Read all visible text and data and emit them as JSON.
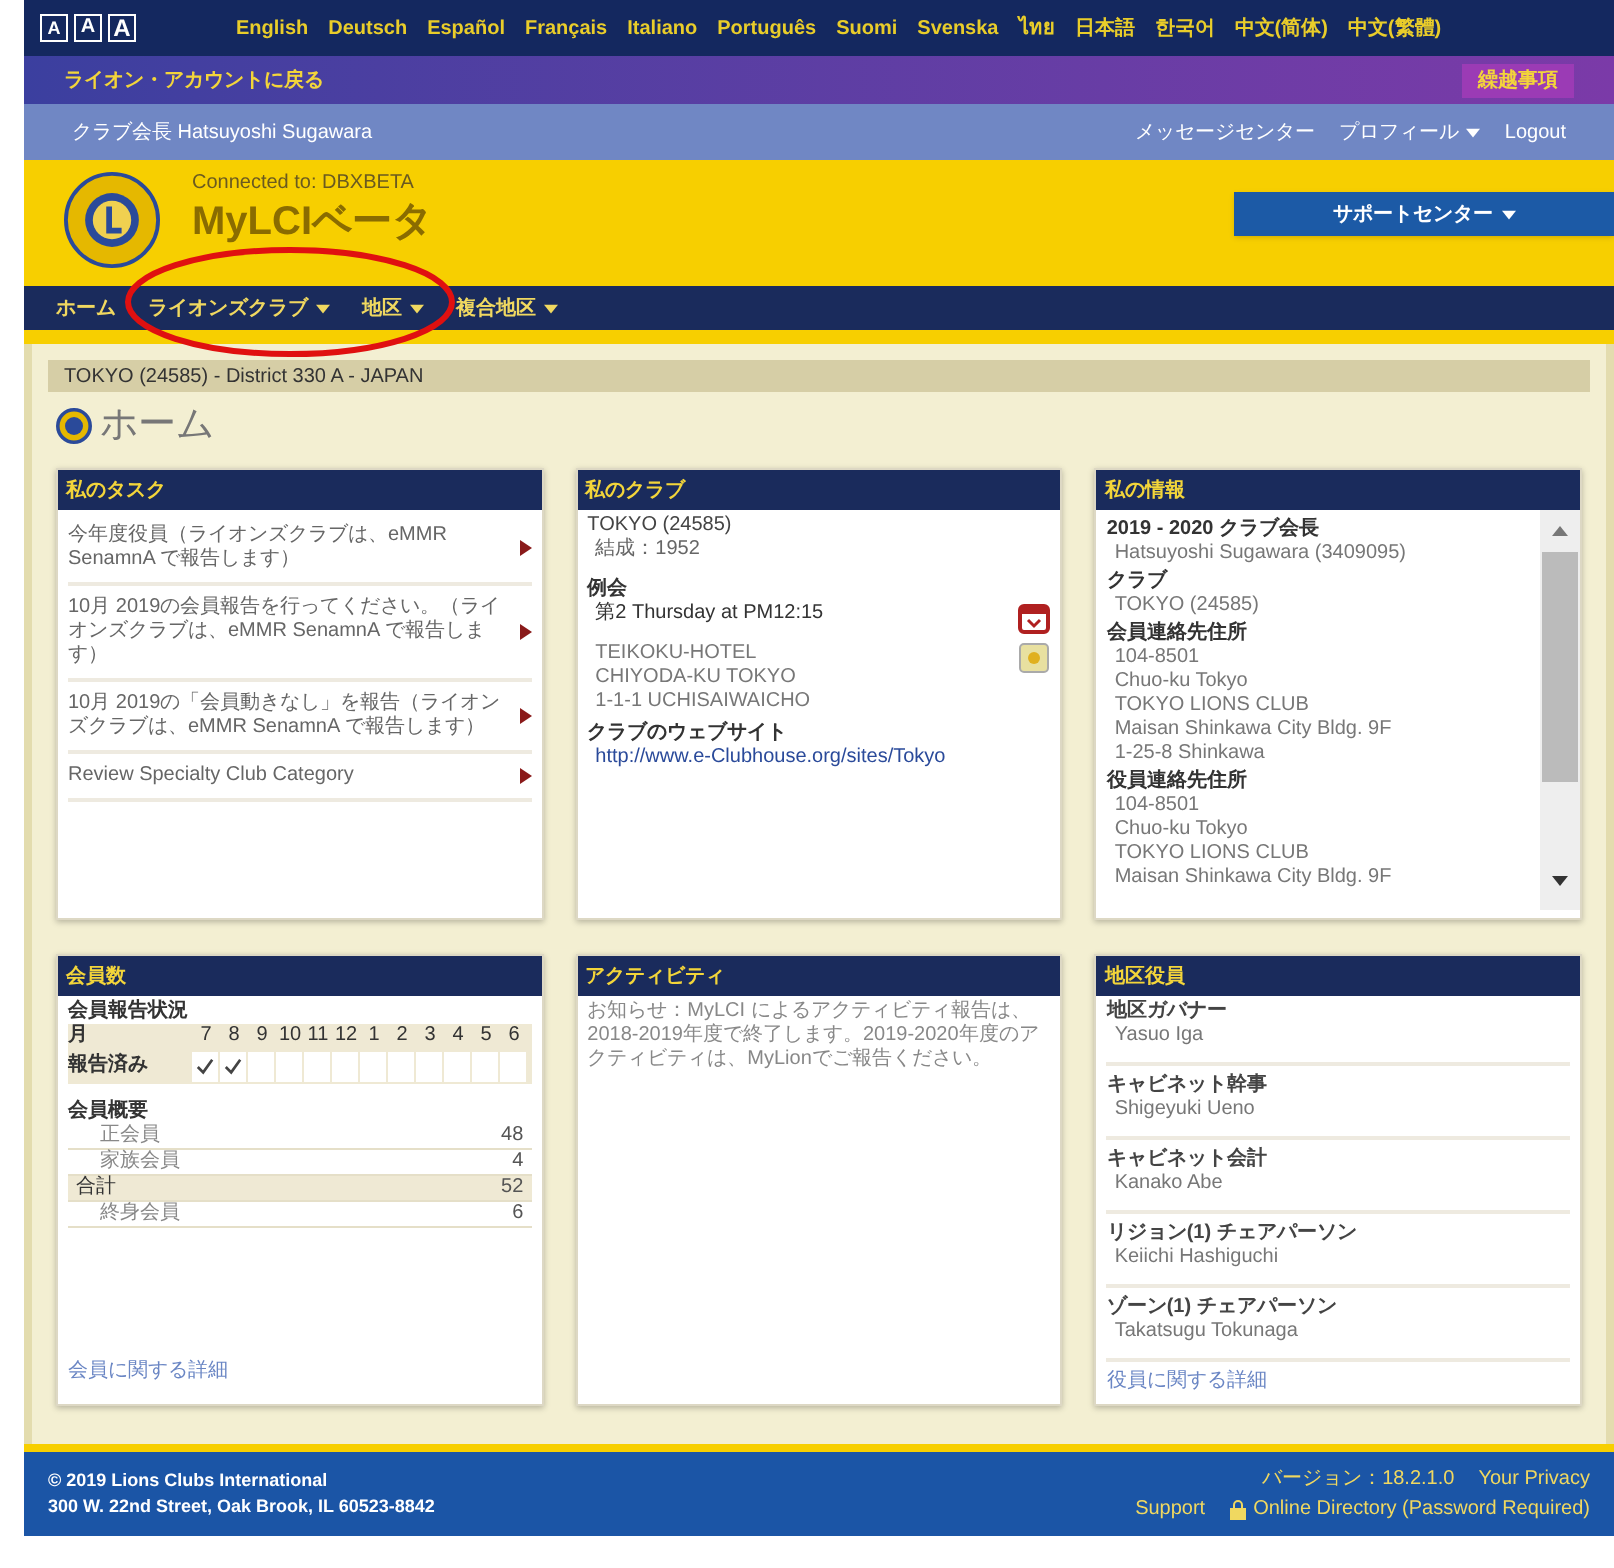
{
  "font_size_buttons": [
    "A",
    "A",
    "A"
  ],
  "languages": [
    "English",
    "Deutsch",
    "Español",
    "Français",
    "Italiano",
    "Português",
    "Suomi",
    "Svenska",
    "ไทย",
    "日本語",
    "한국어",
    "中文(简体)",
    "中文(繁體)"
  ],
  "account_bar": {
    "back_link": "ライオン・アカウントに戻る",
    "badge": "繰越事項"
  },
  "user_bar": {
    "user": "クラブ会長 Hatsuyoshi Sugawara",
    "links": [
      {
        "label": "メッセージセンター",
        "dropdown": false
      },
      {
        "label": "プロフィール",
        "dropdown": true
      },
      {
        "label": "Logout",
        "dropdown": false
      }
    ]
  },
  "header": {
    "connection": "Connected to: DBXBETA",
    "app_title": "MyLCIベータ",
    "support_button": "サポートセンター"
  },
  "nav": [
    {
      "label": "ホーム",
      "dropdown": false
    },
    {
      "label": "ライオンズクラブ",
      "dropdown": true
    },
    {
      "label": "地区",
      "dropdown": true
    },
    {
      "label": "複合地区",
      "dropdown": true
    }
  ],
  "breadcrumb": "TOKYO (24585) - District 330 A - JAPAN",
  "page_title": "ホーム",
  "cards": [
    {
      "kind": "tasks",
      "title": "私のタスク",
      "items": [
        "今年度役員（ライオンズクラブは、eMMR SenamnA で報告します）",
        "10月 2019の会員報告を行ってください。（ライオンズクラブは、eMMR SenamnA で報告します）",
        "10月 2019の「会員動きなし」を報告（ライオンズクラブは、eMMR SenamnA で報告します）",
        "Review Specialty Club Category"
      ]
    },
    {
      "kind": "club",
      "title": "私のクラブ",
      "club": "TOKYO (24585)",
      "chartered": "結成：1952",
      "meeting_heading": "例会",
      "meeting_time": "第2 Thursday at PM12:15",
      "venue": [
        "TEIKOKU-HOTEL",
        "CHIYODA-KU TOKYO",
        "1-1-1 UCHISAIWAICHO"
      ],
      "website_heading": "クラブのウェブサイト",
      "website_url": "http://www.e-Clubhouse.org/sites/Tokyo"
    },
    {
      "kind": "info",
      "title": "私の情報",
      "sections": [
        {
          "heading": "2019 - 2020 クラブ会長",
          "lines": [
            "Hatsuyoshi Sugawara (3409095)"
          ]
        },
        {
          "heading": "クラブ",
          "lines": [
            "TOKYO (24585)"
          ]
        },
        {
          "heading": "会員連絡先住所",
          "lines": [
            "104-8501",
            "Chuo-ku Tokyo",
            "TOKYO LIONS CLUB",
            "Maisan Shinkawa City Bldg. 9F",
            "1-25-8 Shinkawa"
          ]
        },
        {
          "heading": "役員連絡先住所",
          "lines": [
            "104-8501",
            "Chuo-ku Tokyo",
            "TOKYO LIONS CLUB",
            "Maisan Shinkawa City Bldg. 9F"
          ]
        }
      ]
    },
    {
      "kind": "members",
      "title": "会員数",
      "status_heading": "会員報告状況",
      "month_label": "月",
      "months": [
        "7",
        "8",
        "9",
        "10",
        "11",
        "12",
        "1",
        "2",
        "3",
        "4",
        "5",
        "6"
      ],
      "reported_label": "報告済み",
      "reported": [
        true,
        true,
        false,
        false,
        false,
        false,
        false,
        false,
        false,
        false,
        false,
        false
      ],
      "summary_heading": "会員概要",
      "summary": [
        {
          "label": "正会員",
          "value": "48",
          "highlighted": false
        },
        {
          "label": "家族会員",
          "value": "4",
          "highlighted": false
        },
        {
          "label": "合計",
          "value": "52",
          "highlighted": true
        },
        {
          "label": "終身会員",
          "value": "6",
          "highlighted": false
        }
      ],
      "more_link": "会員に関する詳細"
    },
    {
      "kind": "activity",
      "title": "アクティビティ",
      "notice": "お知らせ：MyLCI によるアクティビティ報告は、2018-2019年度で終了します。2019-2020年度のアクティビティは、MyLionでご報告ください。"
    },
    {
      "kind": "officers",
      "title": "地区役員",
      "officers": [
        {
          "role": "地区ガバナー",
          "name": "Yasuo Iga"
        },
        {
          "role": "キャビネット幹事",
          "name": "Shigeyuki Ueno"
        },
        {
          "role": "キャビネット会計",
          "name": "Kanako Abe"
        },
        {
          "role": "リジョン(1) チェアパーソン",
          "name": "Keiichi Hashiguchi"
        },
        {
          "role": "ゾーン(1) チェアパーソン",
          "name": "Takatsugu Tokunaga"
        }
      ],
      "more_link": "役員に関する詳細"
    }
  ],
  "footer": {
    "copyright": "© 2019 Lions Clubs International",
    "address": "300 W. 22nd Street, Oak Brook, IL 60523-8842",
    "version": "バージョン：18.2.1.0",
    "links": [
      {
        "label": "Your Privacy",
        "locked": false
      },
      {
        "label": "Support",
        "locked": false
      },
      {
        "label": "Online Directory (Password Required)",
        "locked": true
      }
    ]
  }
}
